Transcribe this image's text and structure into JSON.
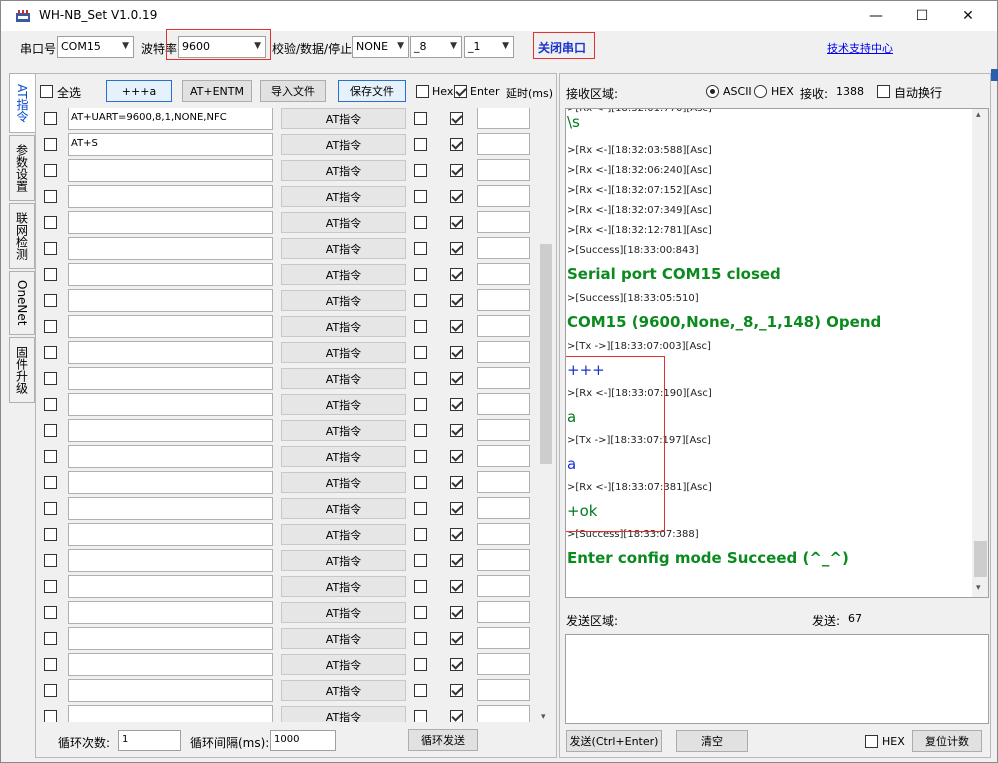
{
  "title": "WH-NB_Set V1.0.19",
  "window_buttons": {
    "min": "—",
    "max": "☐",
    "close": "✕"
  },
  "toolbar": {
    "port_label": "串口号",
    "port_value": "COM15",
    "baud_label": "波特率",
    "baud_value": "9600",
    "params_label": "校验/数据/停止",
    "parity_value": "NONE",
    "data_value": "_8",
    "stop_value": "_1",
    "close_port": "关闭串口",
    "support_link": "技术支持中心"
  },
  "tabs": [
    "AT指令",
    "参数设置",
    "联网检测",
    "OneNet",
    "固件升级"
  ],
  "left": {
    "select_all": "全选",
    "btn_plus": "+++a",
    "btn_entm": "AT+ENTM",
    "btn_import": "导入文件",
    "btn_save": "保存文件",
    "hex_label": "Hex",
    "enter_label": "Enter",
    "delay_label": "延时(ms)",
    "at_button": "AT指令",
    "commands": [
      "AT+UART=9600,8,1,NONE,NFC",
      "AT+S",
      "",
      "",
      "",
      "",
      "",
      "",
      "",
      "",
      "",
      "",
      "",
      "",
      "",
      "",
      "",
      "",
      "",
      "",
      "",
      "",
      "",
      "",
      ""
    ],
    "loop_count_label": "循环次数:",
    "loop_count_value": "1",
    "loop_interval_label": "循环间隔(ms):",
    "loop_interval_value": "1000",
    "loop_send": "循环发送"
  },
  "right": {
    "recv_label": "接收区域:",
    "ascii": "ASCII",
    "hex": "HEX",
    "recv_count_label": "接收:",
    "recv_count": "1388",
    "autowrap": "自动换行",
    "log": [
      {
        "text": "\\s",
        "style": "g"
      },
      {
        "text": ">[Rx <-][18:32:03:588][Asc]",
        "style": "sm"
      },
      {
        "text": ">[Rx <-][18:32:06:240][Asc]",
        "style": "sm"
      },
      {
        "text": ">[Rx <-][18:32:07:152][Asc]",
        "style": "sm"
      },
      {
        "text": ">[Rx <-][18:32:07:349][Asc]",
        "style": "sm"
      },
      {
        "text": ">[Rx <-][18:32:12:781][Asc]",
        "style": "sm"
      },
      {
        "text": ">[Success][18:33:00:843]",
        "style": "sm"
      },
      {
        "text": "Serial port COM15 closed",
        "style": "gb"
      },
      {
        "text": ">[Success][18:33:05:510]",
        "style": "sm"
      },
      {
        "text": "COM15 (9600,None,_8,_1,148) Opend",
        "style": "gb"
      },
      {
        "text": ">[Tx ->][18:33:07:003][Asc]",
        "style": "sm"
      },
      {
        "text": "+++",
        "style": "b"
      },
      {
        "text": ">[Rx <-][18:33:07:190][Asc]",
        "style": "sm"
      },
      {
        "text": "a",
        "style": "g"
      },
      {
        "text": ">[Tx ->][18:33:07:197][Asc]",
        "style": "sm"
      },
      {
        "text": "a",
        "style": "b"
      },
      {
        "text": ">[Rx <-][18:33:07:381][Asc]",
        "style": "sm"
      },
      {
        "text": "+ok",
        "style": "g"
      },
      {
        "text": ">[Success][18:33:07:388]",
        "style": "sm"
      },
      {
        "text": "Enter config mode Succeed   (^_^)",
        "style": "gb"
      }
    ],
    "send_label": "发送区域:",
    "send_count_label": "发送:",
    "send_count": "67",
    "send_btn": "发送(Ctrl+Enter)",
    "clear_btn": "清空",
    "hex_send": "HEX",
    "reset_count": "复位计数"
  }
}
